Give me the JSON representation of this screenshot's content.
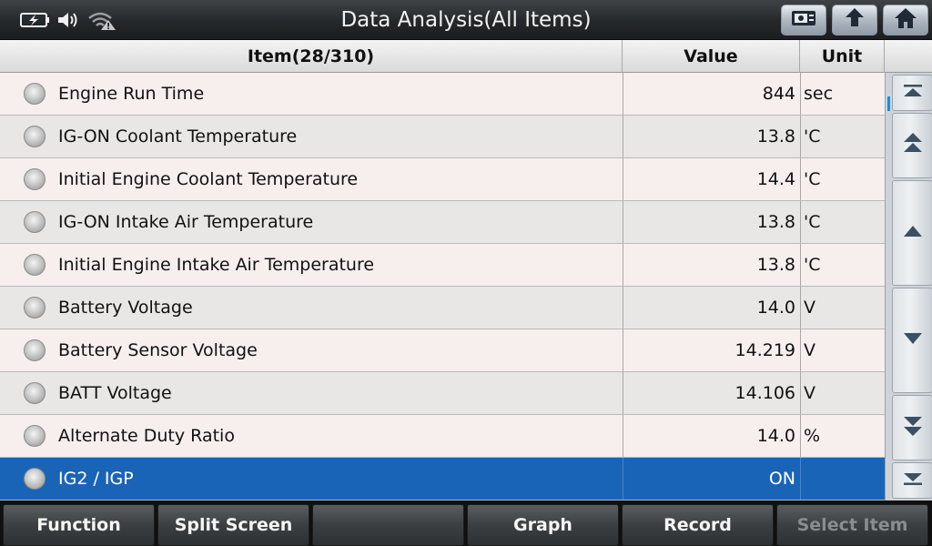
{
  "title": "Data Analysis(All Items)",
  "status_icons": [
    "battery-charging-icon",
    "speaker-icon",
    "wifi-warning-icon"
  ],
  "toolbar_buttons": [
    "screenshot-icon",
    "back-icon",
    "home-icon"
  ],
  "table": {
    "headers": {
      "item": "Item(28/310)",
      "value": "Value",
      "unit": "Unit"
    },
    "rows": [
      {
        "name": "Engine Run Time",
        "value": "844",
        "unit": "sec"
      },
      {
        "name": "IG-ON Coolant Temperature",
        "value": "13.8",
        "unit": "'C"
      },
      {
        "name": "Initial Engine Coolant Temperature",
        "value": "14.4",
        "unit": "'C"
      },
      {
        "name": "IG-ON Intake Air Temperature",
        "value": "13.8",
        "unit": "'C"
      },
      {
        "name": "Initial Engine Intake Air Temperature",
        "value": "13.8",
        "unit": "'C"
      },
      {
        "name": "Battery Voltage",
        "value": "14.0",
        "unit": "V"
      },
      {
        "name": "Battery Sensor Voltage",
        "value": "14.219",
        "unit": "V"
      },
      {
        "name": "BATT Voltage",
        "value": "14.106",
        "unit": "V"
      },
      {
        "name": "Alternate Duty Ratio",
        "value": "14.0",
        "unit": "%"
      },
      {
        "name": "IG2 / IGP",
        "value": "ON",
        "unit": ""
      }
    ],
    "selected_row": 9
  },
  "scroll_buttons": [
    "scroll-top-icon",
    "page-up-icon",
    "line-up-icon",
    "line-down-icon",
    "page-down-icon",
    "scroll-bottom-icon"
  ],
  "bottom_buttons": [
    {
      "label": "Function",
      "enabled": true
    },
    {
      "label": "Split Screen",
      "enabled": true
    },
    {
      "label": "",
      "enabled": true
    },
    {
      "label": "Graph",
      "enabled": true
    },
    {
      "label": "Record",
      "enabled": true
    },
    {
      "label": "Select Item",
      "enabled": false
    }
  ],
  "colors": {
    "selected_row": "#1a64b8",
    "accent_scroll": "#1e8ed8"
  }
}
